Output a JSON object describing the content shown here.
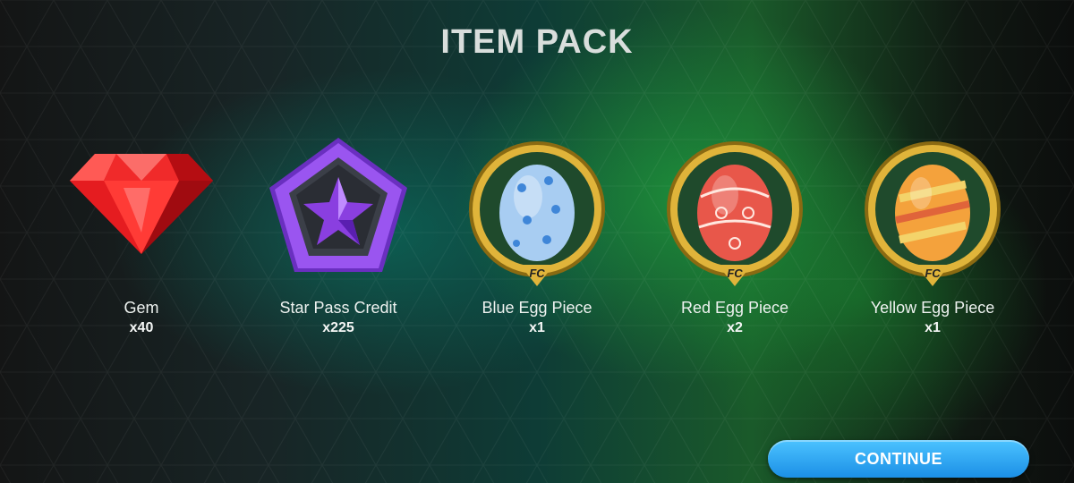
{
  "header": {
    "title": "ITEM PACK"
  },
  "items": [
    {
      "name": "Gem",
      "qty": "x40",
      "icon": "gem-icon"
    },
    {
      "name": "Star Pass Credit",
      "qty": "x225",
      "icon": "star-pass-credit-icon"
    },
    {
      "name": "Blue Egg Piece",
      "qty": "x1",
      "icon": "blue-egg-icon"
    },
    {
      "name": "Red Egg Piece",
      "qty": "x2",
      "icon": "red-egg-icon"
    },
    {
      "name": "Yellow Egg Piece",
      "qty": "x1",
      "icon": "yellow-egg-icon"
    }
  ],
  "footer": {
    "continue_label": "CONTINUE"
  },
  "colors": {
    "accent": "#2aa8f2",
    "gold": "#e0b43a",
    "gem": "#e51c20",
    "star_pass": "#8a3fe0"
  }
}
